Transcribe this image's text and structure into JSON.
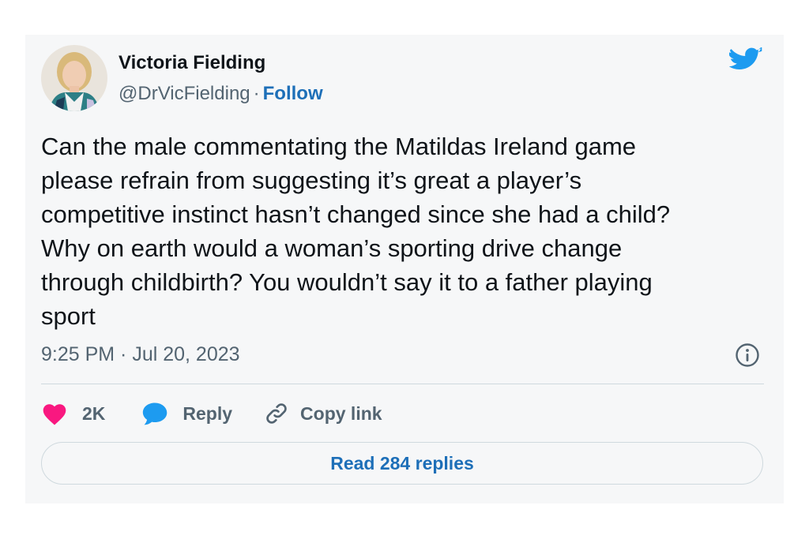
{
  "author": {
    "name": "Victoria Fielding",
    "handle": "@DrVicFielding",
    "separator": "·",
    "follow_label": "Follow"
  },
  "tweet": {
    "text": "Can the male commentating the Matildas Ireland game\nplease refrain from suggesting it’s great a player’s\ncompetitive instinct hasn’t changed since she had a child?\nWhy on earth would a woman’s sporting drive change\nthrough childbirth? You wouldn’t say it to a father playing\nsport",
    "timestamp": "9:25 PM · Jul 20, 2023"
  },
  "actions": {
    "like_count": "2K",
    "reply_label": "Reply",
    "copy_link_label": "Copy link"
  },
  "read_replies_label": "Read 284 replies",
  "icons": {
    "brand": "twitter-bird-icon",
    "info": "info-icon",
    "like": "heart-icon",
    "reply": "speech-bubble-icon",
    "copy": "link-icon"
  },
  "colors": {
    "twitter_blue": "#1d9bf0",
    "link_blue": "#1d6fb8",
    "like_pink": "#f91880",
    "text_dark": "#0f1419",
    "text_muted": "#536471"
  }
}
